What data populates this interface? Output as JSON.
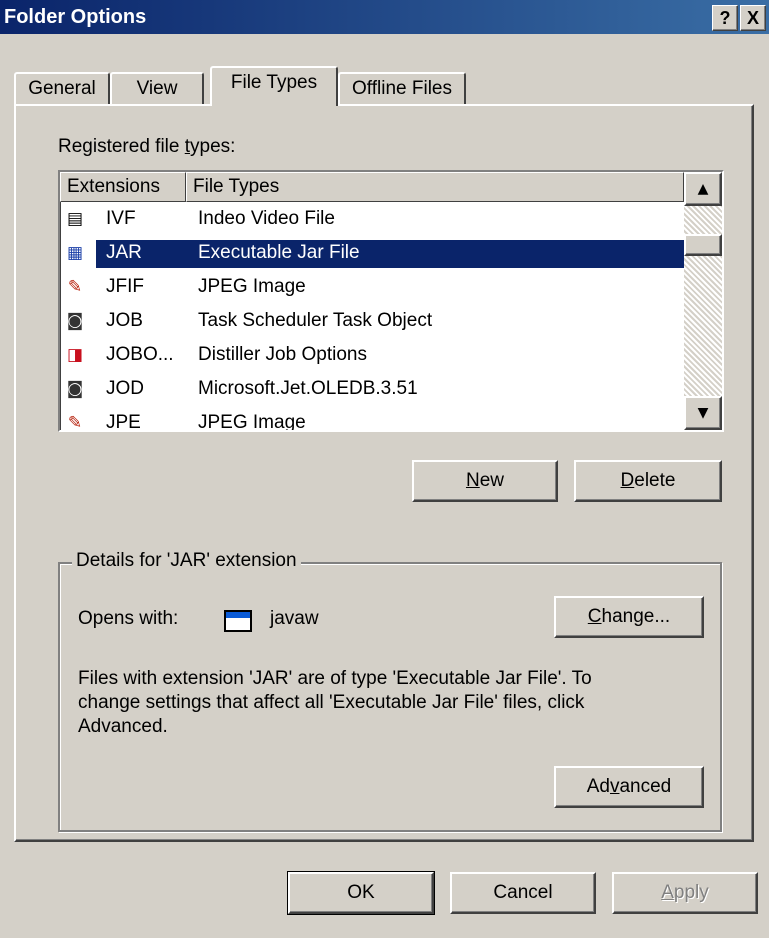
{
  "window": {
    "title": "Folder Options",
    "help_label": "?",
    "close_label": "X"
  },
  "tabs": [
    {
      "label": "General"
    },
    {
      "label": "View"
    },
    {
      "label": "File Types"
    },
    {
      "label": "Offline Files"
    }
  ],
  "registered": {
    "label_pre": "Registered file ",
    "label_acc": "t",
    "label_post": "ypes:"
  },
  "columns": {
    "extensions": "Extensions",
    "file_types": "File Types"
  },
  "rows": [
    {
      "ext": "IVF",
      "type": "Indeo Video File",
      "icon": "video-file-icon",
      "glyph": "▤"
    },
    {
      "ext": "JAR",
      "type": "Executable Jar File",
      "icon": "jar-file-icon",
      "glyph": "▦",
      "selected": true
    },
    {
      "ext": "JFIF",
      "type": "JPEG Image",
      "icon": "image-file-icon",
      "glyph": "✎"
    },
    {
      "ext": "JOB",
      "type": "Task Scheduler Task Object",
      "icon": "task-file-icon",
      "glyph": "◙"
    },
    {
      "ext": "JOBO...",
      "type": "Distiller Job Options",
      "icon": "pdf-file-icon",
      "glyph": "◨"
    },
    {
      "ext": "JOD",
      "type": "Microsoft.Jet.OLEDB.3.51",
      "icon": "task-file-icon",
      "glyph": "◙"
    },
    {
      "ext": "JPE",
      "type": "JPEG Image",
      "icon": "image-file-icon",
      "glyph": "✎"
    }
  ],
  "buttons": {
    "new": {
      "acc": "N",
      "rest": "ew"
    },
    "delete": {
      "acc": "D",
      "rest": "elete"
    },
    "change": {
      "acc": "C",
      "rest": "hange..."
    },
    "advanced": {
      "pre": "Ad",
      "acc": "v",
      "rest": "anced"
    },
    "ok": "OK",
    "cancel": "Cancel",
    "apply": {
      "acc": "A",
      "rest": "pply"
    }
  },
  "details": {
    "title": "Details for 'JAR' extension",
    "opens_with_label": "Opens with:",
    "app_name": "javaw",
    "description_line1": "Files with extension 'JAR' are of type 'Executable Jar File'.  To",
    "description_line2": "change settings that affect all 'Executable Jar File' files, click",
    "description_line3": "Advanced."
  },
  "colors": {
    "selection": "#0a246a",
    "face": "#d4d0c8",
    "title_start": "#0a246a",
    "title_end": "#3a6ea5"
  }
}
